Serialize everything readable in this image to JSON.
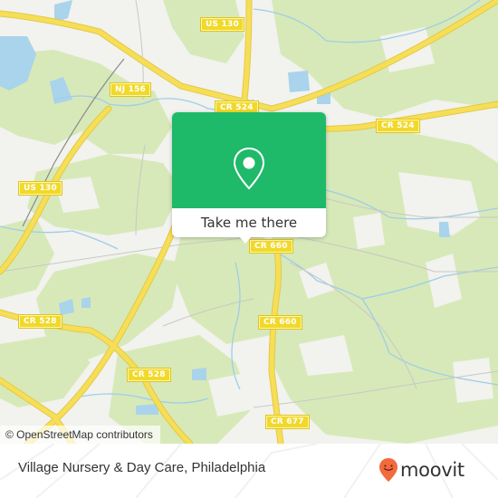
{
  "map": {
    "road_labels": [
      {
        "id": "us130-top",
        "text": "US 130"
      },
      {
        "id": "nj156",
        "text": "NJ 156"
      },
      {
        "id": "cr524-left",
        "text": "CR 524"
      },
      {
        "id": "cr524-right",
        "text": "CR 524"
      },
      {
        "id": "us130-left",
        "text": "US 130"
      },
      {
        "id": "cr660-top",
        "text": "CR 660"
      },
      {
        "id": "cr528-left",
        "text": "CR 528"
      },
      {
        "id": "cr660-mid",
        "text": "CR 660"
      },
      {
        "id": "cr528-mid",
        "text": "CR 528"
      },
      {
        "id": "cr677",
        "text": "CR 677"
      }
    ],
    "attribution": "© OpenStreetMap contributors",
    "colors": {
      "land": "#f2f2ee",
      "forest": "#d7e9b9",
      "water": "#aad3ec",
      "road": "#f6df56",
      "shield": "#f1d92a"
    }
  },
  "popup": {
    "action_label": "Take me there",
    "icon": "map-pin-icon",
    "color": "#1fb96a"
  },
  "footer": {
    "place_name": "Village Nursery & Day Care, Philadelphia",
    "brand": "moovit",
    "brand_icon": "moovit-logo-icon",
    "brand_color": "#f26a3d"
  }
}
